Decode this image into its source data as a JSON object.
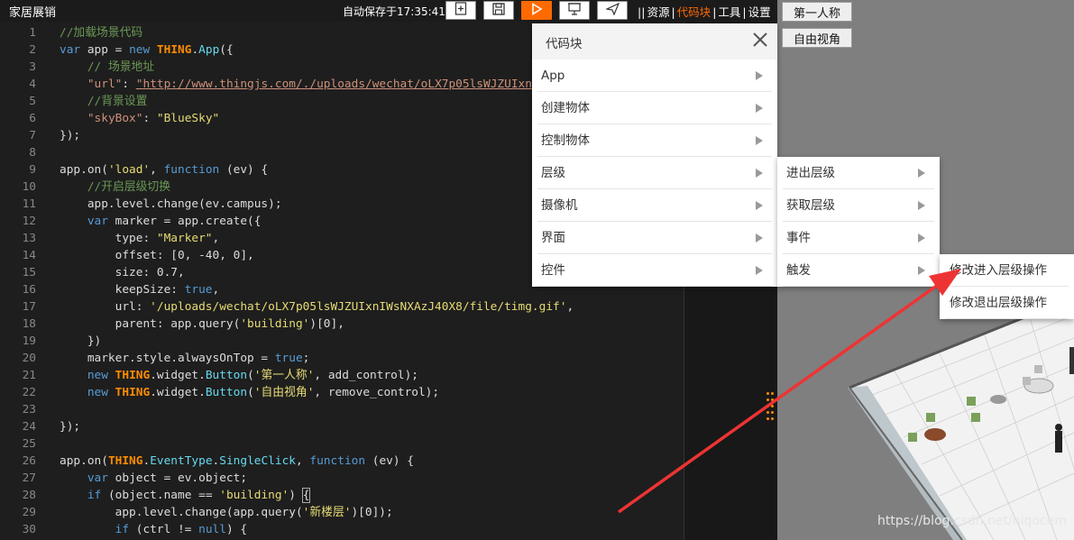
{
  "topbar": {
    "title": "家居展销",
    "autosave": "自动保存于17:35:41",
    "buttons": [
      {
        "icon": "new-file-icon"
      },
      {
        "icon": "save-icon"
      },
      {
        "icon": "play-icon"
      },
      {
        "icon": "presentation-icon"
      },
      {
        "icon": "send-icon"
      }
    ],
    "links": [
      "资源",
      "代码块",
      "工具",
      "设置"
    ],
    "active_link": "代码块",
    "accent": "#ff6a00"
  },
  "editor": {
    "lines": [
      {
        "n": "1",
        "t": [
          [
            "cm",
            "//加载场景代码"
          ]
        ]
      },
      {
        "n": "2",
        "t": [
          [
            "kw",
            "var"
          ],
          [
            "def",
            " app = "
          ],
          [
            "kw",
            "new"
          ],
          [
            "def",
            " "
          ],
          [
            "cls",
            "THING"
          ],
          [
            "def",
            "."
          ],
          [
            "fn",
            "App"
          ],
          [
            "def",
            "({"
          ]
        ]
      },
      {
        "n": "3",
        "t": [
          [
            "def",
            "    "
          ],
          [
            "cm",
            "// 场景地址"
          ]
        ]
      },
      {
        "n": "4",
        "t": [
          [
            "def",
            "    "
          ],
          [
            "strq",
            "\"url\""
          ],
          [
            "def",
            ": "
          ],
          [
            "url",
            "\"http://www.thingjs.com/./uploads/wechat/oLX7p05lsWJZUIxn"
          ]
        ]
      },
      {
        "n": "5",
        "t": [
          [
            "def",
            "    "
          ],
          [
            "cm",
            "//背景设置"
          ]
        ]
      },
      {
        "n": "6",
        "t": [
          [
            "def",
            "    "
          ],
          [
            "strq",
            "\"skyBox\""
          ],
          [
            "def",
            ": "
          ],
          [
            "str",
            "\"BlueSky\""
          ]
        ]
      },
      {
        "n": "7",
        "t": [
          [
            "def",
            "});"
          ]
        ]
      },
      {
        "n": "8",
        "t": []
      },
      {
        "n": "9",
        "t": [
          [
            "def",
            "app.on("
          ],
          [
            "str",
            "'load'"
          ],
          [
            "def",
            ", "
          ],
          [
            "kw",
            "function"
          ],
          [
            "def",
            " (ev) {"
          ]
        ]
      },
      {
        "n": "10",
        "t": [
          [
            "def",
            "    "
          ],
          [
            "cm",
            "//开启层级切换"
          ]
        ]
      },
      {
        "n": "11",
        "t": [
          [
            "def",
            "    app.level.change(ev.campus);"
          ]
        ]
      },
      {
        "n": "12",
        "t": [
          [
            "def",
            "    "
          ],
          [
            "kw",
            "var"
          ],
          [
            "def",
            " marker = app.create({"
          ]
        ]
      },
      {
        "n": "13",
        "t": [
          [
            "def",
            "        type: "
          ],
          [
            "str",
            "\"Marker\""
          ],
          [
            "def",
            ","
          ]
        ]
      },
      {
        "n": "14",
        "t": [
          [
            "def",
            "        offset: [0, -40, 0],"
          ]
        ]
      },
      {
        "n": "15",
        "t": [
          [
            "def",
            "        size: 0.7,"
          ]
        ]
      },
      {
        "n": "16",
        "t": [
          [
            "def",
            "        keepSize: "
          ],
          [
            "true",
            "true"
          ],
          [
            "def",
            ","
          ]
        ]
      },
      {
        "n": "17",
        "t": [
          [
            "def",
            "        url: "
          ],
          [
            "str",
            "'/uploads/wechat/oLX7p05lsWJZUIxnIWsNXAzJ40X8/file/timg.gif'"
          ],
          [
            "def",
            ","
          ]
        ]
      },
      {
        "n": "18",
        "t": [
          [
            "def",
            "        parent: app.query("
          ],
          [
            "str",
            "'building'"
          ],
          [
            "def",
            ")[0],"
          ]
        ]
      },
      {
        "n": "19",
        "t": [
          [
            "def",
            "    })"
          ]
        ]
      },
      {
        "n": "20",
        "t": [
          [
            "def",
            "    marker.style.alwaysOnTop = "
          ],
          [
            "true",
            "true"
          ],
          [
            "def",
            ";"
          ]
        ]
      },
      {
        "n": "21",
        "t": [
          [
            "def",
            "    "
          ],
          [
            "kw",
            "new"
          ],
          [
            "def",
            " "
          ],
          [
            "cls",
            "THING"
          ],
          [
            "def",
            ".widget."
          ],
          [
            "fn",
            "Button"
          ],
          [
            "def",
            "("
          ],
          [
            "str",
            "'第一人称'"
          ],
          [
            "def",
            ", add_control);"
          ]
        ]
      },
      {
        "n": "22",
        "t": [
          [
            "def",
            "    "
          ],
          [
            "kw",
            "new"
          ],
          [
            "def",
            " "
          ],
          [
            "cls",
            "THING"
          ],
          [
            "def",
            ".widget."
          ],
          [
            "fn",
            "Button"
          ],
          [
            "def",
            "("
          ],
          [
            "str",
            "'自由视角'"
          ],
          [
            "def",
            ", remove_control);"
          ]
        ]
      },
      {
        "n": "23",
        "t": []
      },
      {
        "n": "24",
        "t": [
          [
            "def",
            "});"
          ]
        ]
      },
      {
        "n": "25",
        "t": []
      },
      {
        "n": "26",
        "t": [
          [
            "def",
            "app.on("
          ],
          [
            "cls",
            "THING"
          ],
          [
            "def",
            "."
          ],
          [
            "fn",
            "EventType"
          ],
          [
            "def",
            "."
          ],
          [
            "fn",
            "SingleClick"
          ],
          [
            "def",
            ", "
          ],
          [
            "kw",
            "function"
          ],
          [
            "def",
            " (ev) {"
          ]
        ]
      },
      {
        "n": "27",
        "t": [
          [
            "def",
            "    "
          ],
          [
            "kw",
            "var"
          ],
          [
            "def",
            " object = ev.object;"
          ]
        ]
      },
      {
        "n": "28",
        "t": [
          [
            "def",
            "    "
          ],
          [
            "kw",
            "if"
          ],
          [
            "def",
            " (object.name == "
          ],
          [
            "str",
            "'building'"
          ],
          [
            "def",
            ") "
          ],
          [
            "box",
            "{"
          ]
        ]
      },
      {
        "n": "29",
        "t": [
          [
            "def",
            "        app.level.change(app.query("
          ],
          [
            "str",
            "'新楼层'"
          ],
          [
            "def",
            ")[0]);"
          ]
        ]
      },
      {
        "n": "30",
        "t": [
          [
            "def",
            "        "
          ],
          [
            "kw",
            "if"
          ],
          [
            "def",
            " (ctrl != "
          ],
          [
            "kw",
            "null"
          ],
          [
            "def",
            ") {"
          ]
        ]
      }
    ]
  },
  "viewport": {
    "buttons": [
      "第一人称",
      "自由视角"
    ],
    "watermark": "https://blog.csdn.net/niqocem"
  },
  "menu_codeblock": {
    "title": "代码块",
    "items": [
      "App",
      "创建物体",
      "控制物体",
      "层级",
      "摄像机",
      "界面",
      "控件"
    ]
  },
  "menu_level": {
    "items": [
      "进出层级",
      "获取层级",
      "事件",
      "触发"
    ]
  },
  "menu_trigger": {
    "items": [
      "修改进入层级操作",
      "修改退出层级操作"
    ]
  },
  "colors": {
    "annotation_arrow": "#ee3333"
  }
}
